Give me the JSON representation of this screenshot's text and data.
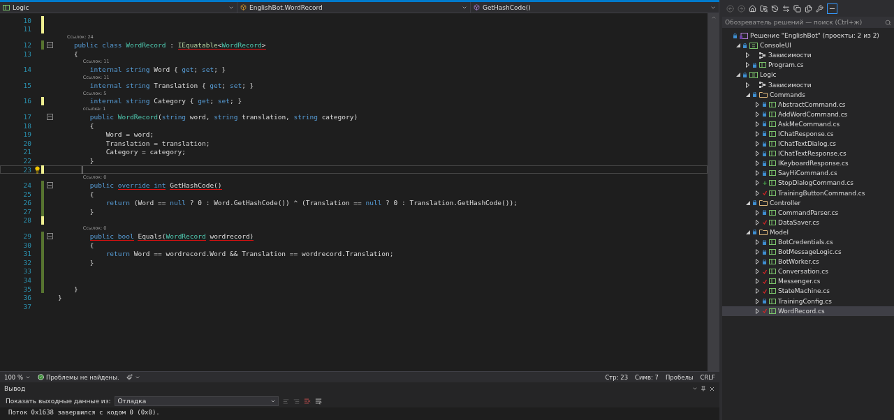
{
  "navbar": {
    "project": "Logic",
    "type": "EnglishBot.WordRecord",
    "member": "GetHashCode()"
  },
  "editor": {
    "lines": [
      {
        "number": "10",
        "unsaved": true,
        "saved": false,
        "foldable": false,
        "current": false
      },
      {
        "number": "11",
        "unsaved": true,
        "saved": false,
        "foldable": false,
        "current": false
      },
      {
        "number": "12",
        "lens": "Ссылок: 24",
        "unsaved": false,
        "saved": true,
        "foldable": true,
        "current": false,
        "tokens": [
          {
            "kind": "kw",
            "text": "    public class ",
            "underlined": false
          },
          {
            "kind": "type",
            "text": "WordRecord",
            "underlined": false
          },
          {
            "kind": "plain",
            "text": " : ",
            "underlined": false
          },
          {
            "kind": "iface",
            "text": "IEquatable",
            "underlined": true
          },
          {
            "kind": "plain",
            "text": "<",
            "underlined": true
          },
          {
            "kind": "type",
            "text": "WordRecord",
            "underlined": true
          },
          {
            "kind": "plain",
            "text": ">",
            "underlined": true
          }
        ]
      },
      {
        "number": "13",
        "unsaved": false,
        "saved": false,
        "foldable": false,
        "current": false,
        "tokens": [
          {
            "kind": "plain",
            "text": "    {",
            "underlined": false
          }
        ]
      },
      {
        "number": "14",
        "lens": "Ссылок: 11",
        "unsaved": false,
        "saved": false,
        "foldable": false,
        "current": false,
        "tokens": [
          {
            "kind": "kw",
            "text": "        internal string ",
            "underlined": false
          },
          {
            "kind": "plain",
            "text": "Word { ",
            "underlined": false
          },
          {
            "kind": "kw",
            "text": "get",
            "underlined": false
          },
          {
            "kind": "plain",
            "text": "; ",
            "underlined": false
          },
          {
            "kind": "kw",
            "text": "set",
            "underlined": false
          },
          {
            "kind": "plain",
            "text": "; }",
            "underlined": false
          }
        ]
      },
      {
        "number": "15",
        "lens": "Ссылок: 11",
        "unsaved": false,
        "saved": false,
        "foldable": false,
        "current": false,
        "tokens": [
          {
            "kind": "kw",
            "text": "        internal string ",
            "underlined": false
          },
          {
            "kind": "plain",
            "text": "Translation { ",
            "underlined": false
          },
          {
            "kind": "kw",
            "text": "get",
            "underlined": false
          },
          {
            "kind": "plain",
            "text": "; ",
            "underlined": false
          },
          {
            "kind": "kw",
            "text": "set",
            "underlined": false
          },
          {
            "kind": "plain",
            "text": "; }",
            "underlined": false
          }
        ]
      },
      {
        "number": "16",
        "lens": "Ссылок: 5",
        "unsaved": true,
        "saved": false,
        "foldable": false,
        "current": false,
        "tokens": [
          {
            "kind": "kw",
            "text": "        internal string ",
            "underlined": false
          },
          {
            "kind": "plain",
            "text": "Category { ",
            "underlined": false
          },
          {
            "kind": "kw",
            "text": "get",
            "underlined": false
          },
          {
            "kind": "plain",
            "text": "; ",
            "underlined": false
          },
          {
            "kind": "kw",
            "text": "set",
            "underlined": false
          },
          {
            "kind": "plain",
            "text": "; }",
            "underlined": false
          }
        ]
      },
      {
        "number": "17",
        "lens": "ссылка: 1",
        "unsaved": false,
        "saved": false,
        "foldable": true,
        "current": false,
        "tokens": [
          {
            "kind": "kw",
            "text": "        public ",
            "underlined": false
          },
          {
            "kind": "type",
            "text": "WordRecord",
            "underlined": false
          },
          {
            "kind": "plain",
            "text": "(",
            "underlined": false
          },
          {
            "kind": "kw",
            "text": "string",
            "underlined": false
          },
          {
            "kind": "plain",
            "text": " word, ",
            "underlined": false
          },
          {
            "kind": "kw",
            "text": "string",
            "underlined": false
          },
          {
            "kind": "plain",
            "text": " translation, ",
            "underlined": false
          },
          {
            "kind": "kw",
            "text": "string",
            "underlined": false
          },
          {
            "kind": "plain",
            "text": " category)",
            "underlined": false
          }
        ]
      },
      {
        "number": "18",
        "unsaved": false,
        "saved": false,
        "foldable": false,
        "current": false,
        "tokens": [
          {
            "kind": "plain",
            "text": "        {",
            "underlined": false
          }
        ]
      },
      {
        "number": "19",
        "unsaved": false,
        "saved": false,
        "foldable": false,
        "current": false,
        "tokens": [
          {
            "kind": "plain",
            "text": "            Word = word;",
            "underlined": false
          }
        ]
      },
      {
        "number": "20",
        "unsaved": false,
        "saved": false,
        "foldable": false,
        "current": false,
        "tokens": [
          {
            "kind": "plain",
            "text": "            Translation = translation;",
            "underlined": false
          }
        ]
      },
      {
        "number": "21",
        "unsaved": false,
        "saved": false,
        "foldable": false,
        "current": false,
        "tokens": [
          {
            "kind": "plain",
            "text": "            Category = category;",
            "underlined": false
          }
        ]
      },
      {
        "number": "22",
        "unsaved": false,
        "saved": false,
        "foldable": false,
        "current": false,
        "tokens": [
          {
            "kind": "plain",
            "text": "        }",
            "underlined": false
          }
        ]
      },
      {
        "number": "23",
        "unsaved": true,
        "saved": false,
        "foldable": false,
        "current": true
      },
      {
        "number": "24",
        "lens": "Ссылок: 0",
        "unsaved": false,
        "saved": true,
        "foldable": true,
        "current": false,
        "tokens": [
          {
            "kind": "kw",
            "text": "        public ",
            "underlined": false
          },
          {
            "kind": "kw",
            "text": "override int",
            "underlined": true
          },
          {
            "kind": "plain",
            "text": " GetHashCode()",
            "underlined": true
          }
        ]
      },
      {
        "number": "25",
        "unsaved": false,
        "saved": true,
        "foldable": false,
        "current": false,
        "tokens": [
          {
            "kind": "plain",
            "text": "        {",
            "underlined": false
          }
        ]
      },
      {
        "number": "26",
        "unsaved": false,
        "saved": true,
        "foldable": false,
        "current": false,
        "tokens": [
          {
            "kind": "kw",
            "text": "            return",
            "underlined": false
          },
          {
            "kind": "plain",
            "text": " (Word == ",
            "underlined": false
          },
          {
            "kind": "kw",
            "text": "null",
            "underlined": false
          },
          {
            "kind": "plain",
            "text": " ? 0 : Word.GetHashCode()) ^ (Translation == ",
            "underlined": false
          },
          {
            "kind": "kw",
            "text": "null",
            "underlined": false
          },
          {
            "kind": "plain",
            "text": " ? 0 : Translation.GetHashCode());",
            "underlined": false
          }
        ]
      },
      {
        "number": "27",
        "unsaved": false,
        "saved": true,
        "foldable": false,
        "current": false,
        "tokens": [
          {
            "kind": "plain",
            "text": "        }",
            "underlined": false
          }
        ]
      },
      {
        "number": "28",
        "unsaved": true,
        "saved": false,
        "foldable": false,
        "current": false
      },
      {
        "number": "29",
        "lens": "Ссылок: 0",
        "unsaved": false,
        "saved": true,
        "foldable": true,
        "current": false,
        "tokens": [
          {
            "kind": "kw",
            "text": "        public bool",
            "underlined": true
          },
          {
            "kind": "plain",
            "text": " Equals(",
            "underlined": true
          },
          {
            "kind": "type",
            "text": "WordRecord",
            "underlined": true
          },
          {
            "kind": "plain",
            "text": " wordrecord)",
            "underlined": true
          }
        ]
      },
      {
        "number": "30",
        "unsaved": false,
        "saved": true,
        "foldable": false,
        "current": false,
        "tokens": [
          {
            "kind": "plain",
            "text": "        {",
            "underlined": false
          }
        ]
      },
      {
        "number": "31",
        "unsaved": false,
        "saved": true,
        "foldable": false,
        "current": false,
        "tokens": [
          {
            "kind": "kw",
            "text": "            return",
            "underlined": false
          },
          {
            "kind": "plain",
            "text": " Word == wordrecord.Word && Translation == wordrecord.Translation;",
            "underlined": false
          }
        ]
      },
      {
        "number": "32",
        "unsaved": false,
        "saved": true,
        "foldable": false,
        "current": false,
        "tokens": [
          {
            "kind": "plain",
            "text": "        }",
            "underlined": false
          }
        ]
      },
      {
        "number": "33",
        "unsaved": false,
        "saved": true,
        "foldable": false,
        "current": false
      },
      {
        "number": "34",
        "unsaved": false,
        "saved": true,
        "foldable": false,
        "current": false
      },
      {
        "number": "35",
        "unsaved": false,
        "saved": true,
        "foldable": false,
        "current": false,
        "tokens": [
          {
            "kind": "plain",
            "text": "    }",
            "underlined": false
          }
        ]
      },
      {
        "number": "36",
        "unsaved": false,
        "saved": false,
        "foldable": false,
        "current": false,
        "tokens": [
          {
            "kind": "plain",
            "text": "}",
            "underlined": false
          }
        ]
      },
      {
        "number": "37",
        "unsaved": false,
        "saved": false,
        "foldable": false,
        "current": false
      }
    ]
  },
  "status_bar": {
    "zoom": "100 %",
    "problems": "Проблемы не найдены.",
    "line": "Стр: 23",
    "column": "Симв: 7",
    "indent": "Пробелы",
    "line_ending": "CRLF"
  },
  "output": {
    "title": "Вывод",
    "source_label": "Показать выходные данные из:",
    "source": "Отладка",
    "lines": [
      "Поток 0x1638 завершился с кодом 0 (0x0)."
    ]
  },
  "explorer": {
    "search": {
      "placeholder": "Обозреватель решений — поиск (Ctrl+ж)"
    },
    "tree": [
      {
        "kind": "solution",
        "label": "Решение \"EnglishBot\" (проекты: 2 из 2)",
        "checked_in": true,
        "checked_out": false,
        "added": false,
        "selected": false,
        "children": [
          {
            "kind": "project",
            "label": "ConsoleUI",
            "checked_in": true,
            "checked_out": false,
            "added": false,
            "expanded": true,
            "selected": false,
            "children": [
              {
                "kind": "deps",
                "label": "Зависимости",
                "checked_in": false,
                "checked_out": false,
                "added": false,
                "expanded": false,
                "selected": false
              },
              {
                "kind": "file",
                "label": "Program.cs",
                "checked_in": true,
                "checked_out": false,
                "added": false,
                "expanded": false,
                "selected": false
              }
            ]
          },
          {
            "kind": "project",
            "label": "Logic",
            "checked_in": true,
            "checked_out": false,
            "added": false,
            "expanded": true,
            "selected": false,
            "children": [
              {
                "kind": "deps",
                "label": "Зависимости",
                "checked_in": false,
                "checked_out": false,
                "added": false,
                "expanded": false,
                "selected": false
              },
              {
                "kind": "folder",
                "label": "Commands",
                "checked_in": true,
                "checked_out": false,
                "added": false,
                "expanded": true,
                "selected": false,
                "children": [
                  {
                    "kind": "file",
                    "label": "AbstractCommand.cs",
                    "checked_in": true,
                    "checked_out": false,
                    "added": false,
                    "expanded": false,
                    "selected": false
                  },
                  {
                    "kind": "file",
                    "label": "AddWordCommand.cs",
                    "checked_in": true,
                    "checked_out": false,
                    "added": false,
                    "expanded": false,
                    "selected": false
                  },
                  {
                    "kind": "file",
                    "label": "AskMeCommand.cs",
                    "checked_in": true,
                    "checked_out": false,
                    "added": false,
                    "expanded": false,
                    "selected": false
                  },
                  {
                    "kind": "file",
                    "label": "IChatResponse.cs",
                    "checked_in": true,
                    "checked_out": false,
                    "added": false,
                    "expanded": false,
                    "selected": false
                  },
                  {
                    "kind": "file",
                    "label": "IChatTextDialog.cs",
                    "checked_in": true,
                    "checked_out": false,
                    "added": false,
                    "expanded": false,
                    "selected": false
                  },
                  {
                    "kind": "file",
                    "label": "IChatTextResponse.cs",
                    "checked_in": true,
                    "checked_out": false,
                    "added": false,
                    "expanded": false,
                    "selected": false
                  },
                  {
                    "kind": "file",
                    "label": "IKeyboardResponse.cs",
                    "checked_in": true,
                    "checked_out": false,
                    "added": false,
                    "expanded": false,
                    "selected": false
                  },
                  {
                    "kind": "file",
                    "label": "SayHiCommand.cs",
                    "checked_in": true,
                    "checked_out": false,
                    "added": false,
                    "expanded": false,
                    "selected": false
                  },
                  {
                    "kind": "file",
                    "label": "StopDialogCommand.cs",
                    "checked_in": false,
                    "checked_out": false,
                    "added": true,
                    "expanded": false,
                    "selected": false
                  },
                  {
                    "kind": "file",
                    "label": "TrainingButtonCommand.cs",
                    "checked_in": false,
                    "checked_out": true,
                    "added": false,
                    "expanded": false,
                    "selected": false
                  }
                ]
              },
              {
                "kind": "folder",
                "label": "Controller",
                "checked_in": true,
                "checked_out": false,
                "added": false,
                "expanded": true,
                "selected": false,
                "children": [
                  {
                    "kind": "file",
                    "label": "CommandParser.cs",
                    "checked_in": true,
                    "checked_out": false,
                    "added": false,
                    "expanded": false,
                    "selected": false
                  },
                  {
                    "kind": "file",
                    "label": "DataSaver.cs",
                    "checked_in": false,
                    "checked_out": true,
                    "added": false,
                    "expanded": false,
                    "selected": false
                  }
                ]
              },
              {
                "kind": "folder",
                "label": "Model",
                "checked_in": true,
                "checked_out": false,
                "added": false,
                "expanded": true,
                "selected": false,
                "children": [
                  {
                    "kind": "file",
                    "label": "BotCredentials.cs",
                    "checked_in": true,
                    "checked_out": false,
                    "added": false,
                    "expanded": false,
                    "selected": false
                  },
                  {
                    "kind": "file",
                    "label": "BotMessageLogic.cs",
                    "checked_in": true,
                    "checked_out": false,
                    "added": false,
                    "expanded": false,
                    "selected": false
                  },
                  {
                    "kind": "file",
                    "label": "BotWorker.cs",
                    "checked_in": true,
                    "checked_out": false,
                    "added": false,
                    "expanded": false,
                    "selected": false
                  },
                  {
                    "kind": "file",
                    "label": "Conversation.cs",
                    "checked_in": false,
                    "checked_out": true,
                    "added": false,
                    "expanded": false,
                    "selected": false
                  },
                  {
                    "kind": "file",
                    "label": "Messenger.cs",
                    "checked_in": false,
                    "checked_out": true,
                    "added": false,
                    "expanded": false,
                    "selected": false
                  },
                  {
                    "kind": "file",
                    "label": "StateMachine.cs",
                    "checked_in": false,
                    "checked_out": true,
                    "added": false,
                    "expanded": false,
                    "selected": false
                  },
                  {
                    "kind": "file",
                    "label": "TrainingConfig.cs",
                    "checked_in": true,
                    "checked_out": false,
                    "added": false,
                    "expanded": false,
                    "selected": false
                  },
                  {
                    "kind": "file",
                    "label": "WordRecord.cs",
                    "checked_in": false,
                    "checked_out": true,
                    "added": false,
                    "expanded": false,
                    "selected": true
                  }
                ]
              }
            ]
          }
        ]
      }
    ]
  }
}
